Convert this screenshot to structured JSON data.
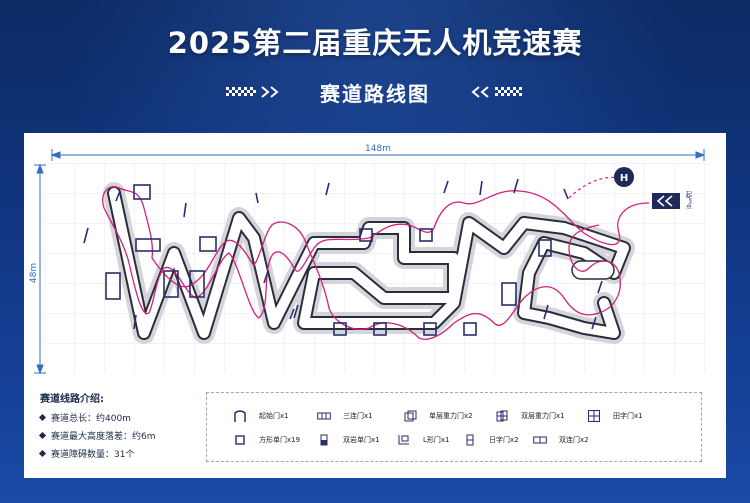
{
  "header": {
    "title": "2025第二届重庆无人机竞速赛",
    "subtitle": "赛道路线图"
  },
  "map": {
    "width_label": "148m",
    "height_label": "48m",
    "start_sign": "起飞点",
    "landing_marker": "H",
    "colors": {
      "track_stroke": "#2b2d3a",
      "track_shadow": "#d3d5da",
      "route": "#d6207a",
      "gate": "#2a2e6b",
      "dimension": "#2e6fc9"
    }
  },
  "info": {
    "title": "赛道线路介绍:",
    "items": [
      "赛道总长：约400m",
      "赛道最大高度落差：约6m",
      "赛道障碍数量：31个"
    ]
  },
  "legend": {
    "items": [
      {
        "icon": "start-gate-icon",
        "label": "起始门x1"
      },
      {
        "icon": "triple-gate-icon",
        "label": "三连门x1"
      },
      {
        "icon": "single-gravity-gate-icon",
        "label": "单层重力门x2"
      },
      {
        "icon": "double-gravity-gate-icon",
        "label": "双层重力门x1"
      },
      {
        "icon": "tian-gate-icon",
        "label": "田字门x1"
      },
      {
        "icon": "square-gate-icon",
        "label": "方形单门x19"
      },
      {
        "icon": "double-deck-gate-icon",
        "label": "双岩单门x1"
      },
      {
        "icon": "l-gate-icon",
        "label": "L形门x1"
      },
      {
        "icon": "ri-gate-icon",
        "label": "日字门x2"
      },
      {
        "icon": "double-link-gate-icon",
        "label": "双连门x2"
      }
    ]
  }
}
